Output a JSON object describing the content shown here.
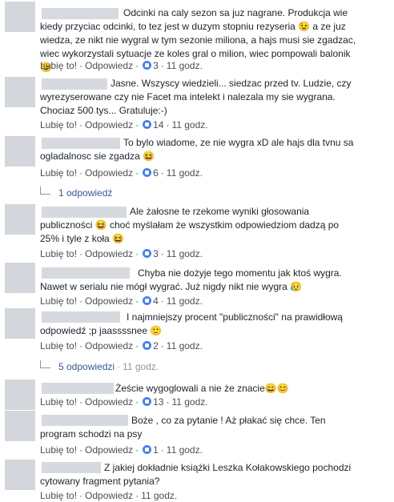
{
  "comments": [
    {
      "text": "Odcinki na caly sezon sa juz nagrane. Produkcja wie kiedy przyciac odcinki, to tez jest w duzym stopniu rezyseria 😉 a ze juz wiedza, ze nikt nie wygral w tym sezonie miliona, a hajs musi sie zgadzac, wiec wykorzystali sytuacje ze koles gral o milion, wiec pompowali balonik 😉",
      "like_label": "Lubię to!",
      "reply_label": "Odpowiedz",
      "likes": "3",
      "time": "11 godz."
    },
    {
      "text": "Jasne. Wszyscy wiedzieli... siedzac przed tv. Ludzie, czy wyrezyserowane czy nie Facet ma intelekt i nalezala my sie wygrana. Chociaz 500 tys... Gratuluje:-)",
      "like_label": "Lubię to!",
      "reply_label": "Odpowiedz",
      "likes": "14",
      "time": "11 godz."
    },
    {
      "text": "To bylo wiadome, ze nie wygra xD ale hajs dla tvnu sa ogladalnosc sie zgadza 😆",
      "like_label": "Lubię to!",
      "reply_label": "Odpowiedz",
      "likes": "6",
      "time": "11 godz.",
      "replies": "1 odpowiedź"
    },
    {
      "text": "Ale żałosne te rzekome wyniki głosowania publiczności 😆 choć myślałam że wszystkim odpowiedziom dadzą po 25% i tyle z koła 😆",
      "like_label": "Lubię to!",
      "reply_label": "Odpowiedz",
      "likes": "3",
      "time": "11 godz."
    },
    {
      "text": "Chyba nie dożyje tego momentu jak ktoś wygra. Nawet w serialu nie mógł wygrać. Już nigdy nikt nie wygra 😥",
      "like_label": "Lubię to!",
      "reply_label": "Odpowiedz",
      "likes": "4",
      "time": "11 godz."
    },
    {
      "text": "I najmniejszy procent \"publiczności\" na prawidłową odpowiedź ;p jaassssnee 🙂",
      "like_label": "Lubię to!",
      "reply_label": "Odpowiedz",
      "likes": "2",
      "time": "11 godz.",
      "replies": "5 odpowiedzi",
      "replies_time": "11 godz."
    },
    {
      "text": "Żeście wygoglowali a nie że znacie😄😊",
      "like_label": "Lubię to!",
      "reply_label": "Odpowiedz",
      "likes": "13",
      "time": "11 godz."
    },
    {
      "text": "Boże , co za pytanie ! Aż płakać się chce. Ten program schodzi na psy",
      "like_label": "Lubię to!",
      "reply_label": "Odpowiedz",
      "likes": "1",
      "time": "11 godz."
    },
    {
      "text": "Z jakiej dokładnie książki Leszka Kołakowskiego pochodzi cytowany fragment pytania?",
      "like_label": "Lubię to!",
      "reply_label": "Odpowiedz",
      "time": "11 godz."
    }
  ]
}
